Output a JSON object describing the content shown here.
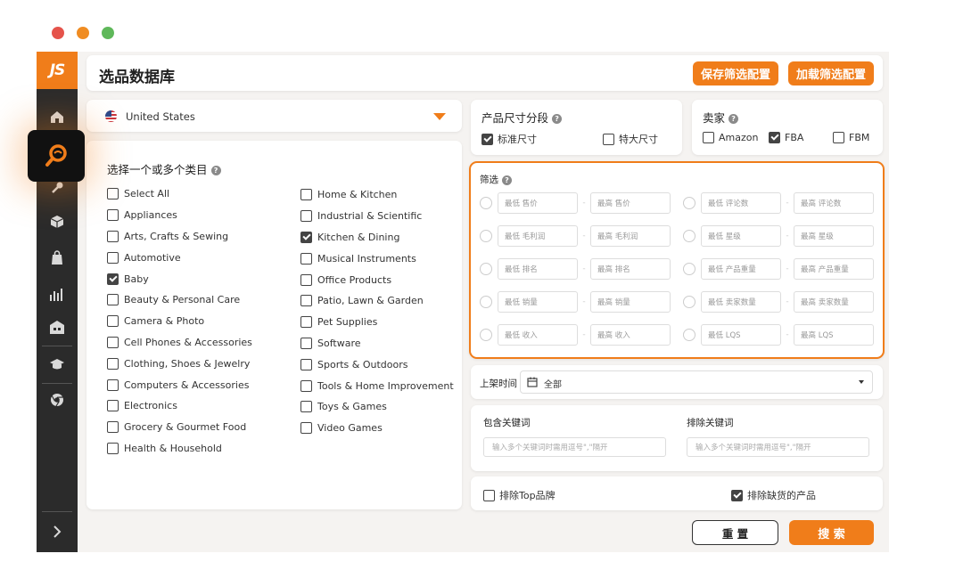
{
  "window": {
    "dots": [
      "#e5534b",
      "#f08c22",
      "#5fb85a"
    ]
  },
  "sidebar": {
    "logo": "JS"
  },
  "header": {
    "title": "选品数据库",
    "save_label": "保存筛选配置",
    "load_label": "加载筛选配置"
  },
  "marketplace": {
    "value": "United States",
    "flag": "us-flag-icon"
  },
  "categories": {
    "heading": "选择一个或多个类目",
    "col1": [
      {
        "label": "Select All",
        "checked": false
      },
      {
        "label": "Appliances",
        "checked": false
      },
      {
        "label": "Arts, Crafts & Sewing",
        "checked": false
      },
      {
        "label": "Automotive",
        "checked": false
      },
      {
        "label": "Baby",
        "checked": true
      },
      {
        "label": "Beauty & Personal Care",
        "checked": false
      },
      {
        "label": "Camera & Photo",
        "checked": false
      },
      {
        "label": "Cell Phones & Accessories",
        "checked": false
      },
      {
        "label": "Clothing, Shoes & Jewelry",
        "checked": false
      },
      {
        "label": "Computers & Accessories",
        "checked": false
      },
      {
        "label": "Electronics",
        "checked": false
      },
      {
        "label": "Grocery & Gourmet Food",
        "checked": false
      },
      {
        "label": "Health & Household",
        "checked": false
      }
    ],
    "col2": [
      {
        "label": "Home & Kitchen",
        "checked": false
      },
      {
        "label": "Industrial & Scientific",
        "checked": false
      },
      {
        "label": "Kitchen & Dining",
        "checked": true
      },
      {
        "label": "Musical Instruments",
        "checked": false
      },
      {
        "label": "Office Products",
        "checked": false
      },
      {
        "label": "Patio, Lawn & Garden",
        "checked": false
      },
      {
        "label": "Pet Supplies",
        "checked": false
      },
      {
        "label": "Software",
        "checked": false
      },
      {
        "label": "Sports & Outdoors",
        "checked": false
      },
      {
        "label": "Tools & Home Improvement",
        "checked": false
      },
      {
        "label": "Toys & Games",
        "checked": false
      },
      {
        "label": "Video Games",
        "checked": false
      }
    ]
  },
  "size_tier": {
    "label": "产品尺寸分段",
    "standard": "标准尺寸",
    "standard_checked": true,
    "oversize": "特大尺寸",
    "oversize_checked": false
  },
  "seller": {
    "label": "卖家",
    "amazon": "Amazon",
    "amazon_checked": false,
    "fba": "FBA",
    "fba_checked": true,
    "fbm": "FBM",
    "fbm_checked": false
  },
  "filters": {
    "label": "筛选",
    "rows": [
      [
        "最低 售价",
        "最高 售价",
        "最低 评论数",
        "最高 评论数"
      ],
      [
        "最低 毛利润",
        "最高 毛利润",
        "最低 星级",
        "最高 星级"
      ],
      [
        "最低 排名",
        "最高 排名",
        "最低 产品重量",
        "最高 产品重量"
      ],
      [
        "最低 销量",
        "最高 销量",
        "最低 卖家数量",
        "最高 卖家数量"
      ],
      [
        "最低 收入",
        "最高 收入",
        "最低 LQS",
        "最高 LQS"
      ]
    ]
  },
  "listing_time": {
    "label": "上架时间",
    "value": "全部"
  },
  "keywords": {
    "include_label": "包含关键词",
    "include_placeholder": "输入多个关键词时需用逗号\",\"隔开",
    "exclude_label": "排除关键词",
    "exclude_placeholder": "输入多个关键词时需用逗号\",\"隔开"
  },
  "options": {
    "exclude_top": "排除Top品牌",
    "exclude_top_checked": false,
    "exclude_oos": "排除缺货的产品",
    "exclude_oos_checked": true
  },
  "actions": {
    "reset": "重 置",
    "search": "搜 索"
  },
  "colors": {
    "accent": "#f07d1a",
    "sidebar": "#2b2b2b"
  }
}
